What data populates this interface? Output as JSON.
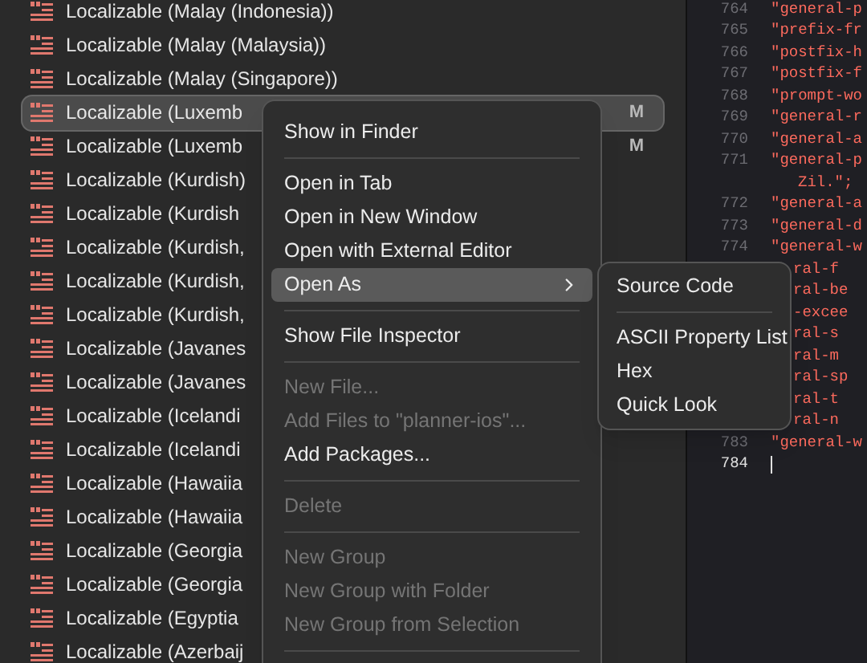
{
  "navigator": {
    "rows": [
      {
        "label": "Localizable (Malay (Indonesia))",
        "selected": false
      },
      {
        "label": "Localizable (Malay (Malaysia))",
        "selected": false
      },
      {
        "label": "Localizable (Malay (Singapore))",
        "selected": false
      },
      {
        "label": "Localizable (Luxemb",
        "selected": true,
        "badge": "M"
      },
      {
        "label": "Localizable (Luxemb",
        "selected": false,
        "badge": "M"
      },
      {
        "label": "Localizable (Kurdish)",
        "selected": false
      },
      {
        "label": "Localizable (Kurdish",
        "selected": false
      },
      {
        "label": "Localizable (Kurdish,",
        "selected": false
      },
      {
        "label": "Localizable (Kurdish,",
        "selected": false
      },
      {
        "label": "Localizable (Kurdish,",
        "selected": false
      },
      {
        "label": "Localizable (Javanes",
        "selected": false
      },
      {
        "label": "Localizable (Javanes",
        "selected": false
      },
      {
        "label": "Localizable (Icelandi",
        "selected": false
      },
      {
        "label": "Localizable (Icelandi",
        "selected": false
      },
      {
        "label": "Localizable (Hawaiia",
        "selected": false
      },
      {
        "label": "Localizable (Hawaiia",
        "selected": false
      },
      {
        "label": "Localizable (Georgia",
        "selected": false
      },
      {
        "label": "Localizable (Georgia",
        "selected": false
      },
      {
        "label": "Localizable (Egyptia",
        "selected": false
      },
      {
        "label": "Localizable (Azerbaij",
        "selected": false
      }
    ]
  },
  "context_menu": {
    "items": [
      {
        "kind": "item",
        "label": "Show in Finder",
        "disabled": false,
        "selected": false,
        "submenu": false
      },
      {
        "kind": "separator"
      },
      {
        "kind": "item",
        "label": "Open in Tab",
        "disabled": false,
        "selected": false,
        "submenu": false
      },
      {
        "kind": "item",
        "label": "Open in New Window",
        "disabled": false,
        "selected": false,
        "submenu": false
      },
      {
        "kind": "item",
        "label": "Open with External Editor",
        "disabled": false,
        "selected": false,
        "submenu": false
      },
      {
        "kind": "item",
        "label": "Open As",
        "disabled": false,
        "selected": true,
        "submenu": true
      },
      {
        "kind": "separator"
      },
      {
        "kind": "item",
        "label": "Show File Inspector",
        "disabled": false,
        "selected": false,
        "submenu": false
      },
      {
        "kind": "separator"
      },
      {
        "kind": "item",
        "label": "New File...",
        "disabled": true,
        "selected": false,
        "submenu": false
      },
      {
        "kind": "item",
        "label": "Add Files to \"planner-ios\"...",
        "disabled": true,
        "selected": false,
        "submenu": false
      },
      {
        "kind": "item",
        "label": "Add Packages...",
        "disabled": false,
        "selected": false,
        "submenu": false
      },
      {
        "kind": "separator"
      },
      {
        "kind": "item",
        "label": "Delete",
        "disabled": true,
        "selected": false,
        "submenu": false
      },
      {
        "kind": "separator"
      },
      {
        "kind": "item",
        "label": "New Group",
        "disabled": true,
        "selected": false,
        "submenu": false
      },
      {
        "kind": "item",
        "label": "New Group with Folder",
        "disabled": true,
        "selected": false,
        "submenu": false
      },
      {
        "kind": "item",
        "label": "New Group from Selection",
        "disabled": true,
        "selected": false,
        "submenu": false
      },
      {
        "kind": "separator"
      }
    ]
  },
  "submenu": {
    "items": [
      {
        "kind": "item",
        "label": "Source Code"
      },
      {
        "kind": "separator"
      },
      {
        "kind": "item",
        "label": "ASCII Property List"
      },
      {
        "kind": "item",
        "label": "Hex"
      },
      {
        "kind": "item",
        "label": "Quick Look"
      }
    ]
  },
  "editor": {
    "lines": [
      {
        "kind": "numbered",
        "number": "764",
        "code": "\"general-p",
        "current": false
      },
      {
        "kind": "numbered",
        "number": "765",
        "code": "\"prefix-fr",
        "current": false
      },
      {
        "kind": "numbered",
        "number": "766",
        "code": "\"postfix-h",
        "current": false
      },
      {
        "kind": "numbered",
        "number": "767",
        "code": "\"postfix-f",
        "current": false
      },
      {
        "kind": "numbered",
        "number": "768",
        "code": "\"prompt-wo",
        "current": false
      },
      {
        "kind": "numbered",
        "number": "769",
        "code": "\"general-r",
        "current": false
      },
      {
        "kind": "numbered",
        "number": "770",
        "code": "\"general-a",
        "current": false
      },
      {
        "kind": "numbered",
        "number": "771",
        "code": "\"general-p",
        "current": false
      },
      {
        "kind": "wrap",
        "code": "Zil.\";"
      },
      {
        "kind": "numbered",
        "number": "772",
        "code": "\"general-a",
        "current": false
      },
      {
        "kind": "numbered",
        "number": "773",
        "code": "\"general-d",
        "current": false
      },
      {
        "kind": "numbered",
        "number": "774",
        "code": "\"general-w",
        "current": false
      },
      {
        "kind": "covered",
        "code": "ral-f"
      },
      {
        "kind": "covered",
        "code": "ral-be"
      },
      {
        "kind": "covered",
        "code": "-excee"
      },
      {
        "kind": "covered",
        "code": "ral-s"
      },
      {
        "kind": "covered",
        "code": "ral-m"
      },
      {
        "kind": "covered",
        "code": "ral-sp"
      },
      {
        "kind": "covered",
        "code": "ral-t"
      },
      {
        "kind": "covered",
        "code": "ral-n"
      },
      {
        "kind": "numbered",
        "number": "783",
        "code": "\"general-w",
        "current": false
      },
      {
        "kind": "numbered",
        "number": "784",
        "current": true
      }
    ]
  }
}
